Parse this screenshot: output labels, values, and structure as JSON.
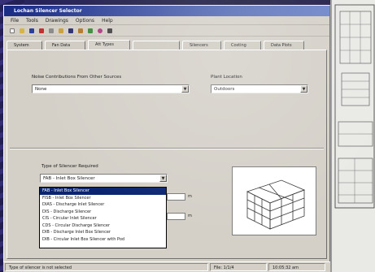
{
  "window": {
    "title": "Lochan Silencer Selector"
  },
  "menu": [
    "File",
    "Tools",
    "Drawings",
    "Options",
    "Help"
  ],
  "toolbar": [
    "new",
    "open",
    "save",
    "cut",
    "print",
    "folder",
    "save-all",
    "drawing",
    "chart",
    "globe",
    "export"
  ],
  "tabs": [
    {
      "label": "System",
      "active": false
    },
    {
      "label": "Fan Data",
      "active": false
    },
    {
      "label": "Att Types",
      "active": true
    },
    {
      "label": "",
      "active": false
    },
    {
      "label": "Silencers",
      "active": false
    },
    {
      "label": "Costing",
      "active": false
    },
    {
      "label": "Data Plots",
      "active": false
    }
  ],
  "noise_contributions": {
    "label": "Noise Contributions From Other Sources",
    "value": "None"
  },
  "plant_location": {
    "label": "Plant Location",
    "value": "Outdoors"
  },
  "silencer_type": {
    "label": "Type of Silencer Required",
    "value": "FAB - Inlet Box Silencer",
    "options": [
      "FAB - Inlet Box Silencer",
      "FISB - Inlet Box Silencer",
      "DIAS - Discharge Inlet Silencer",
      "DIS - Discharge Silencer",
      "CIS - Circular Inlet Silencer",
      "CDS - Circular Discharge Silencer",
      "DIB - Discharge Inlet Box Silencer",
      "DIB - Circular Inlet Box Silencer with Pod"
    ],
    "selected_index": 0
  },
  "unit_labels": [
    "m",
    "m"
  ],
  "status": {
    "message": "Type of silencer is not selected",
    "file": "File: 1/1/4",
    "time": "10:05:32 am"
  }
}
